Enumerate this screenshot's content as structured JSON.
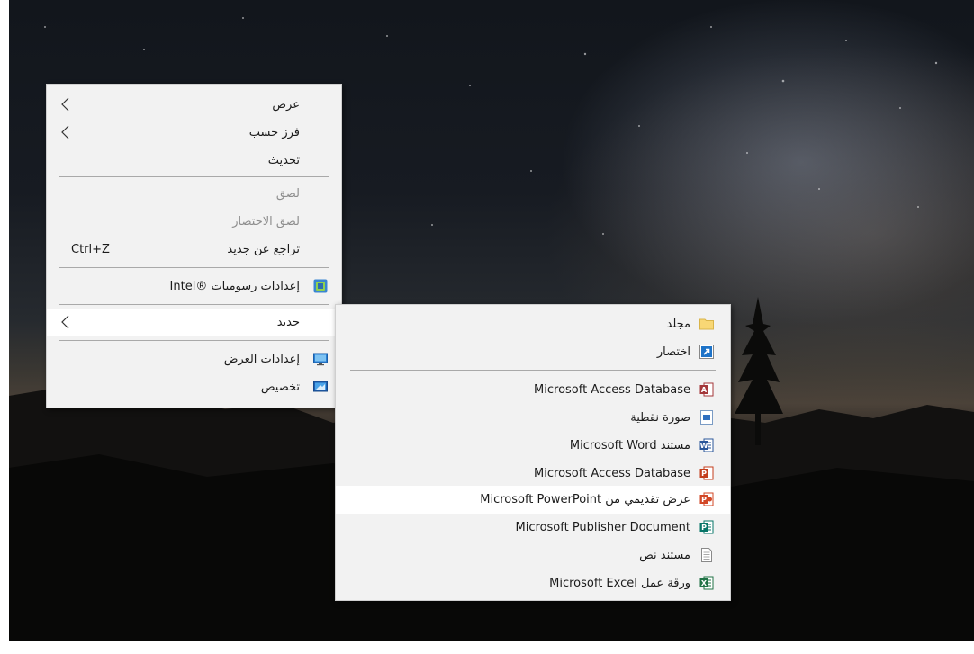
{
  "context_menu": {
    "items": [
      {
        "label": "عرض",
        "submenu": true
      },
      {
        "label": "فرز حسب",
        "submenu": true
      },
      {
        "label": "تحديث"
      },
      {
        "label": "لصق",
        "disabled": true
      },
      {
        "label": "لصق الاختصار",
        "disabled": true
      },
      {
        "label": "تراجع عن جديد",
        "shortcut": "Ctrl+Z"
      },
      {
        "label": "إعدادات رسوميات ®Intel",
        "icon": "intel-graphics-icon"
      },
      {
        "label": "جديد",
        "submenu": true,
        "highlighted": true
      },
      {
        "label": "إعدادات العرض",
        "icon": "display-settings-icon"
      },
      {
        "label": "تخصيص",
        "icon": "personalize-icon"
      }
    ]
  },
  "new_submenu": {
    "items": [
      {
        "label": "مجلد",
        "icon": "folder-icon"
      },
      {
        "label": "اختصار",
        "icon": "shortcut-icon"
      },
      {
        "label": "Microsoft Access Database",
        "icon": "access-icon"
      },
      {
        "label": "صورة نقطية",
        "icon": "bitmap-icon"
      },
      {
        "label": "مستند Microsoft Word",
        "icon": "word-icon"
      },
      {
        "label": "Microsoft Access Database",
        "icon": "access-icon"
      },
      {
        "label": "عرض تقديمي من Microsoft PowerPoint",
        "icon": "powerpoint-icon",
        "highlighted": true
      },
      {
        "label": "Microsoft Publisher Document",
        "icon": "publisher-icon"
      },
      {
        "label": "مستند نص",
        "icon": "text-document-icon"
      },
      {
        "label": "ورقة عمل Microsoft Excel",
        "icon": "excel-icon"
      }
    ]
  },
  "colors": {
    "menu_bg": "#f2f2f2",
    "highlight_bg": "#ffffff",
    "disabled_text": "#8e8e8e",
    "separator": "#a9a9a9"
  }
}
